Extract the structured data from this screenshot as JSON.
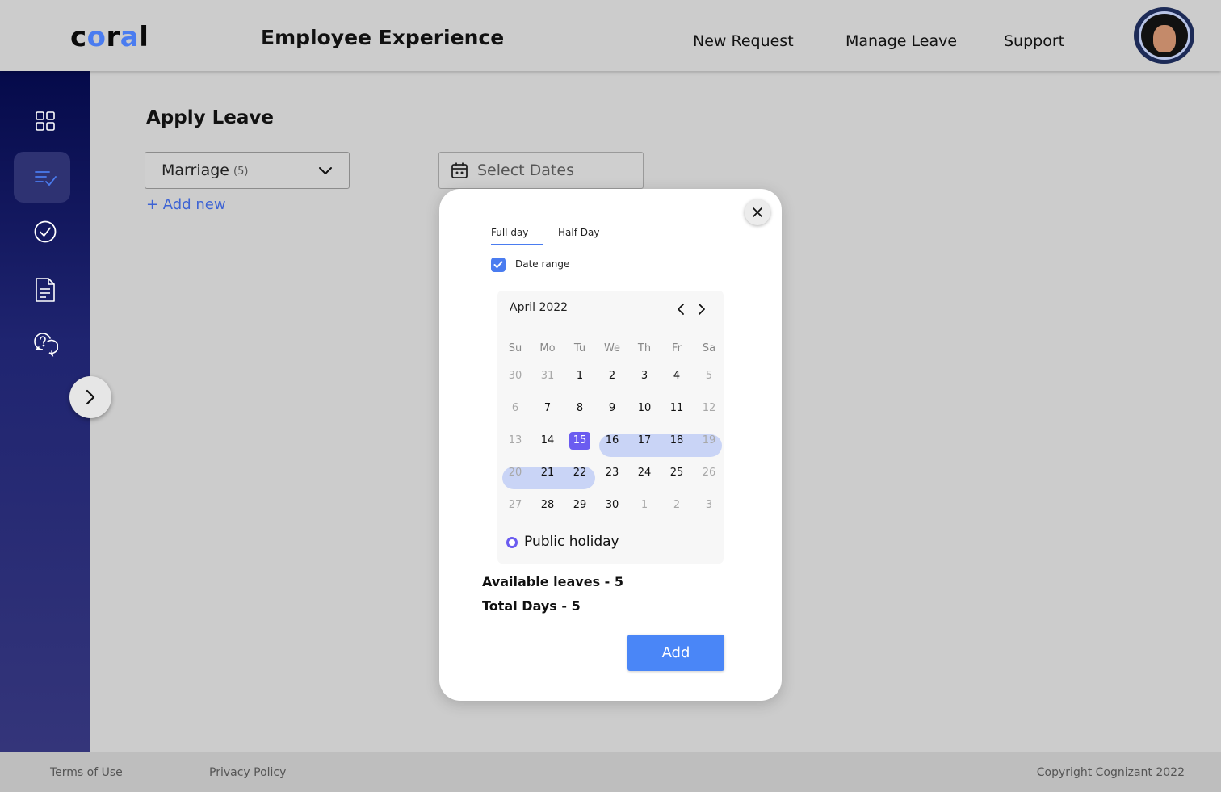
{
  "header": {
    "logo": "coral",
    "app_title": "Employee Experience",
    "nav": [
      "New Request",
      "Manage Leave",
      "Support"
    ]
  },
  "sidebar": {
    "items": [
      {
        "icon": "dashboard-grid-icon"
      },
      {
        "icon": "task-list-check-icon",
        "active": true
      },
      {
        "icon": "check-circle-icon"
      },
      {
        "icon": "document-icon"
      },
      {
        "icon": "help-chat-icon"
      }
    ]
  },
  "main": {
    "title": "Apply Leave",
    "leave_type": {
      "value": "Marriage",
      "count": "(5)"
    },
    "add_new": "+ Add new",
    "date_input": {
      "placeholder": "Select Dates"
    }
  },
  "modal": {
    "tabs": [
      "Full day",
      "Half Day"
    ],
    "active_tab": "Full day",
    "date_range_label": "Date range",
    "date_range_checked": true,
    "calendar": {
      "month": "April 2022",
      "weekdays": [
        "Su",
        "Mo",
        "Tu",
        "We",
        "Th",
        "Fr",
        "Sa"
      ],
      "weeks": [
        [
          "30",
          "31",
          "1",
          "2",
          "3",
          "4",
          "5"
        ],
        [
          "6",
          "7",
          "8",
          "9",
          "10",
          "11",
          "12"
        ],
        [
          "13",
          "14",
          "15",
          "16",
          "17",
          "18",
          "19"
        ],
        [
          "20",
          "21",
          "22",
          "23",
          "24",
          "25",
          "26"
        ],
        [
          "27",
          "28",
          "29",
          "30",
          "1",
          "2",
          "3"
        ]
      ],
      "selected_start": "15",
      "selected_range": [
        "16",
        "17",
        "18",
        "19",
        "20",
        "21",
        "22"
      ]
    },
    "legend": "Public holiday",
    "available_leaves": "Available leaves - 5",
    "total_days": "Total Days - 5",
    "add_button": "Add"
  },
  "footer": {
    "terms": "Terms of Use",
    "privacy": "Privacy Policy",
    "copyright": "Copyright Cognizant 2022"
  },
  "colors": {
    "accent": "#4a7cf0",
    "selected": "#6b5cf0",
    "range": "#c9d4f6",
    "sidebar_top": "#050a4a",
    "sidebar_bottom": "#34357a"
  }
}
